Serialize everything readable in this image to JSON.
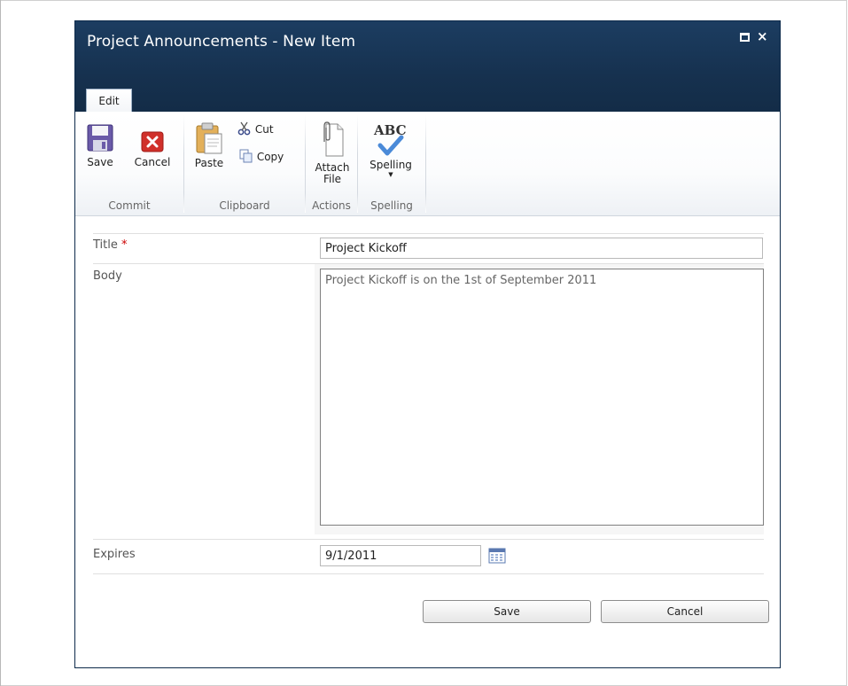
{
  "window": {
    "title": "Project Announcements - New Item",
    "maximize_icon": "maximize-icon",
    "close_icon": "close-icon",
    "close_glyph": "×"
  },
  "ribbon": {
    "tab_label": "Edit",
    "groups": {
      "commit": {
        "label": "Commit",
        "save_label": "Save",
        "cancel_label": "Cancel"
      },
      "clipboard": {
        "label": "Clipboard",
        "paste_label": "Paste",
        "cut_label": "Cut",
        "copy_label": "Copy"
      },
      "actions": {
        "label": "Actions",
        "attach_line1": "Attach",
        "attach_line2": "File"
      },
      "spelling": {
        "label": "Spelling",
        "spelling_label": "Spelling",
        "abc": "ABC"
      }
    }
  },
  "form": {
    "title_label": "Title",
    "required_mark": "*",
    "title_value": "Project Kickoff",
    "body_label": "Body",
    "body_value": "Project Kickoff is on the 1st of September 2011",
    "expires_label": "Expires",
    "expires_value": "9/1/2011"
  },
  "buttons": {
    "save": "Save",
    "cancel": "Cancel"
  },
  "colors": {
    "titlebar": "#16314f",
    "required": "#cc0000",
    "save_icon": "#5a4a9a",
    "cancel_icon": "#d0302a"
  }
}
